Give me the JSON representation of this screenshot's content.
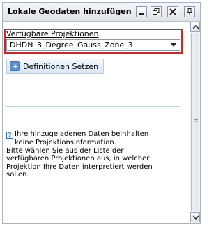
{
  "window": {
    "title": "Lokale Geodaten hinzufügen",
    "buttons": [
      {
        "name": "minimize-icon",
        "glyph": "_"
      },
      {
        "name": "restore-icon",
        "glyph": "restore"
      },
      {
        "name": "close-icon",
        "glyph": "x"
      },
      {
        "name": "pin-icon",
        "glyph": "pin"
      }
    ]
  },
  "projection": {
    "label": "Verfügbare Projektionen",
    "selected": "DHDN_3_Degree_Gauss_Zone_3"
  },
  "actions": {
    "set_definitions_label": "Definitionen Setzen",
    "set_definitions_icon": "arrow-right-icon"
  },
  "info": {
    "icon": "help-icon",
    "icon_glyph": "?",
    "line1": "Ihre hinzugeladenen Daten beinhalten",
    "line2": "keine Projektionsinformation.",
    "line3": "Bitte wählen Sie aus der Liste der",
    "line4": "verfügbaren Projektionen aus, in welcher",
    "line5": "Projektion Ihre Daten interpretiert werden",
    "line6": "sollen."
  },
  "colors": {
    "highlight_border": "#d9221d",
    "button_fill": "#d8e6f7",
    "icon_blue": "#5b8fd4"
  }
}
